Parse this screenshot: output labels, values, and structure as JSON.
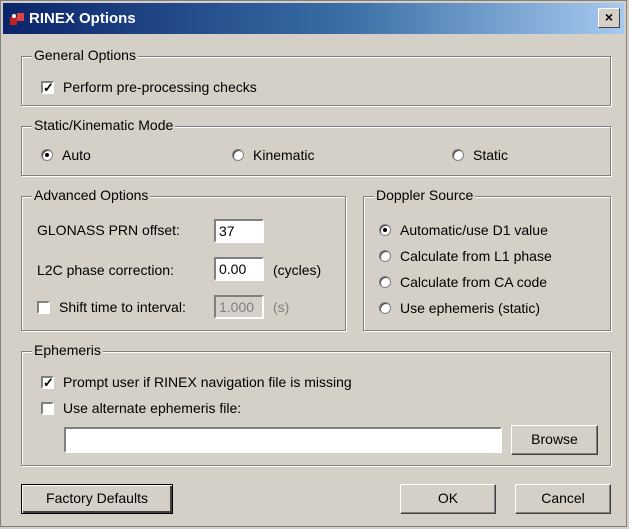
{
  "window": {
    "title": "RINEX Options",
    "close_label": "×"
  },
  "general": {
    "title": "General Options",
    "preprocess_label": "Perform pre-processing checks",
    "preprocess_checked": true
  },
  "mode": {
    "title": "Static/Kinematic Mode",
    "options": [
      "Auto",
      "Kinematic",
      "Static"
    ],
    "selected": "Auto"
  },
  "advanced": {
    "title": "Advanced Options",
    "glonass_label": "GLONASS PRN offset:",
    "glonass_value": "37",
    "l2c_label": "L2C phase correction:",
    "l2c_value": "0.00",
    "l2c_unit": "(cycles)",
    "shift_label": "Shift time to interval:",
    "shift_value": "1.000",
    "shift_unit": "(s)",
    "shift_checked": false
  },
  "doppler": {
    "title": "Doppler Source",
    "options": [
      "Automatic/use D1 value",
      "Calculate from L1 phase",
      "Calculate from CA code",
      "Use ephemeris (static)"
    ],
    "selected": "Automatic/use D1 value"
  },
  "ephemeris": {
    "title": "Ephemeris",
    "prompt_label": "Prompt user if RINEX navigation file is missing",
    "prompt_checked": true,
    "alt_label": "Use alternate ephemeris file:",
    "alt_checked": false,
    "file_value": "",
    "browse_label": "Browse"
  },
  "buttons": {
    "factory": "Factory Defaults",
    "ok": "OK",
    "cancel": "Cancel"
  }
}
